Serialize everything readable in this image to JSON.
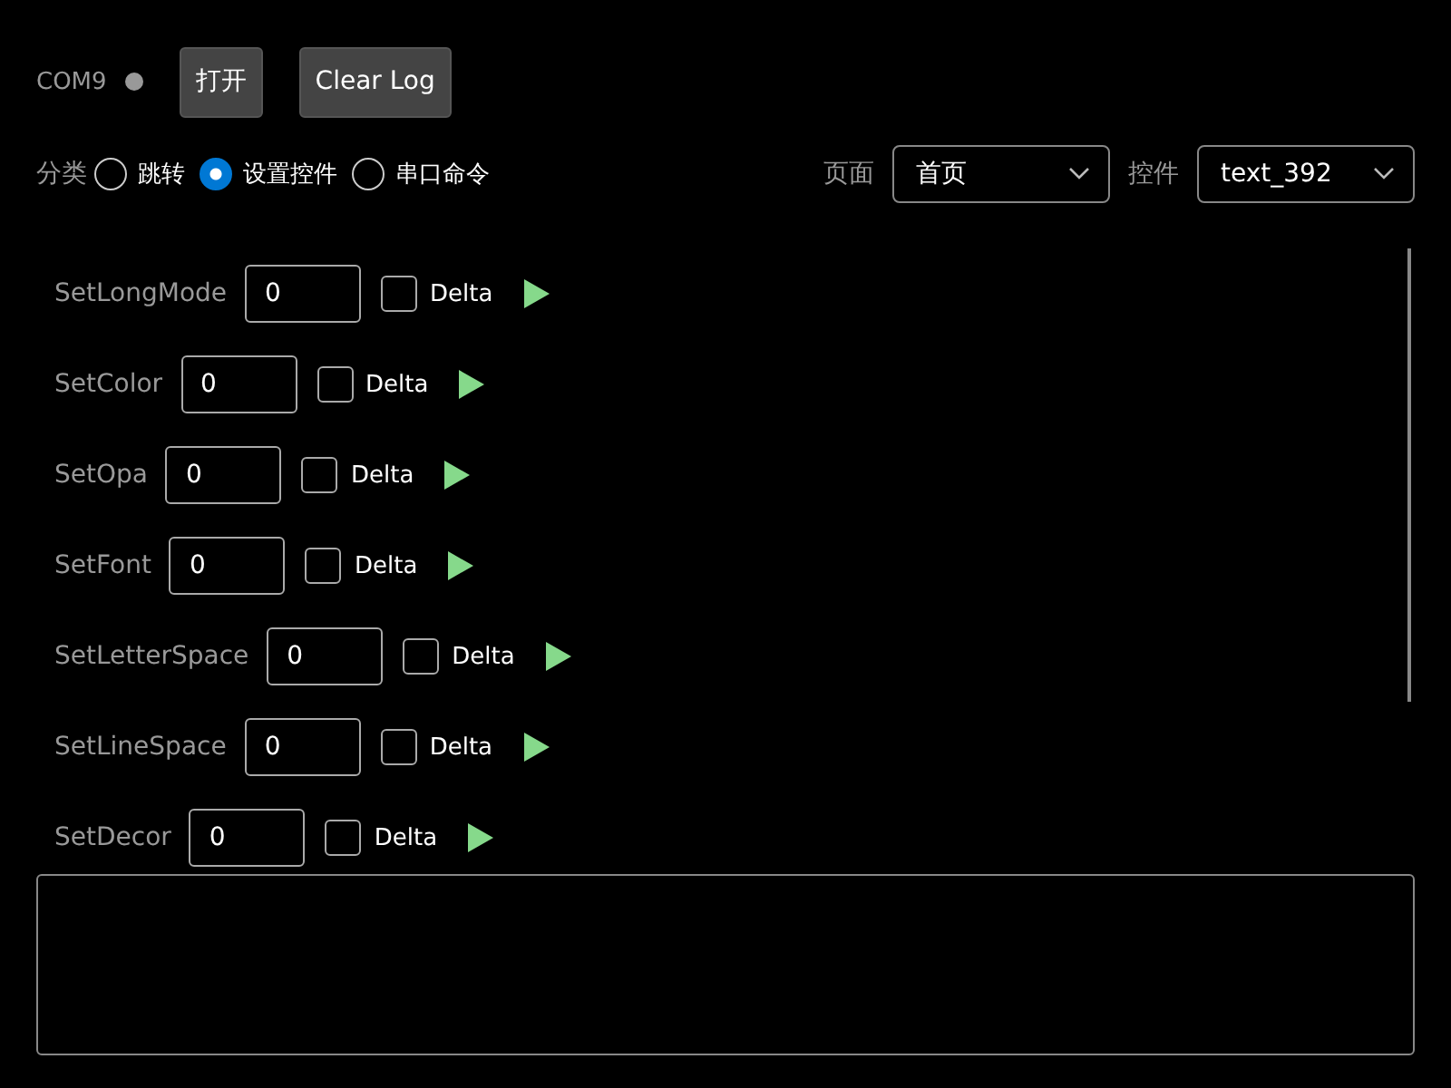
{
  "port": {
    "name": "COM9",
    "connected": false
  },
  "buttons": [
    {
      "label": "打开"
    },
    {
      "label": "Clear Log"
    }
  ],
  "category": {
    "label": "分类",
    "options": [
      {
        "label": "跳转",
        "selected": false
      },
      {
        "label": "设置控件",
        "selected": true
      },
      {
        "label": "串口命令",
        "selected": false
      }
    ]
  },
  "selectors": [
    {
      "label": "页面",
      "value": "首页"
    },
    {
      "label": "控件",
      "value": "text_392"
    }
  ],
  "commands": [
    {
      "name": "SetLongMode",
      "value": "0",
      "delta_label": "Delta",
      "delta": false
    },
    {
      "name": "SetColor",
      "value": "0",
      "delta_label": "Delta",
      "delta": false
    },
    {
      "name": "SetOpa",
      "value": "0",
      "delta_label": "Delta",
      "delta": false
    },
    {
      "name": "SetFont",
      "value": "0",
      "delta_label": "Delta",
      "delta": false
    },
    {
      "name": "SetLetterSpace",
      "value": "0",
      "delta_label": "Delta",
      "delta": false
    },
    {
      "name": "SetLineSpace",
      "value": "0",
      "delta_label": "Delta",
      "delta": false
    },
    {
      "name": "SetDecor",
      "value": "0",
      "delta_label": "Delta",
      "delta": false
    }
  ]
}
